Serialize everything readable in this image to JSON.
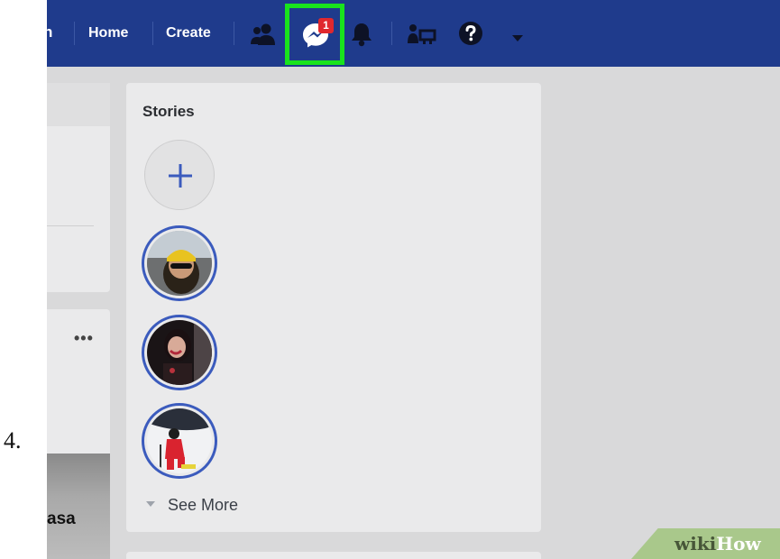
{
  "step": {
    "number": "4."
  },
  "navbar": {
    "cut_label": "n",
    "home_label": "Home",
    "create_label": "Create",
    "icons": [
      "friends-icon",
      "messenger-icon",
      "notifications-icon",
      "find-friends-icon",
      "help-icon",
      "dropdown-arrow-icon"
    ],
    "messenger_badge": "1",
    "bg_color": "#1f3b8c",
    "highlight_color": "#19e31d"
  },
  "feed": {
    "post_menu": "•••",
    "photo_caption_fragment": "asa"
  },
  "stories": {
    "title": "Stories",
    "add_icon": "plus-icon",
    "see_more_label": "See More"
  },
  "watermark": {
    "part1": "wiki",
    "part2": "How"
  }
}
